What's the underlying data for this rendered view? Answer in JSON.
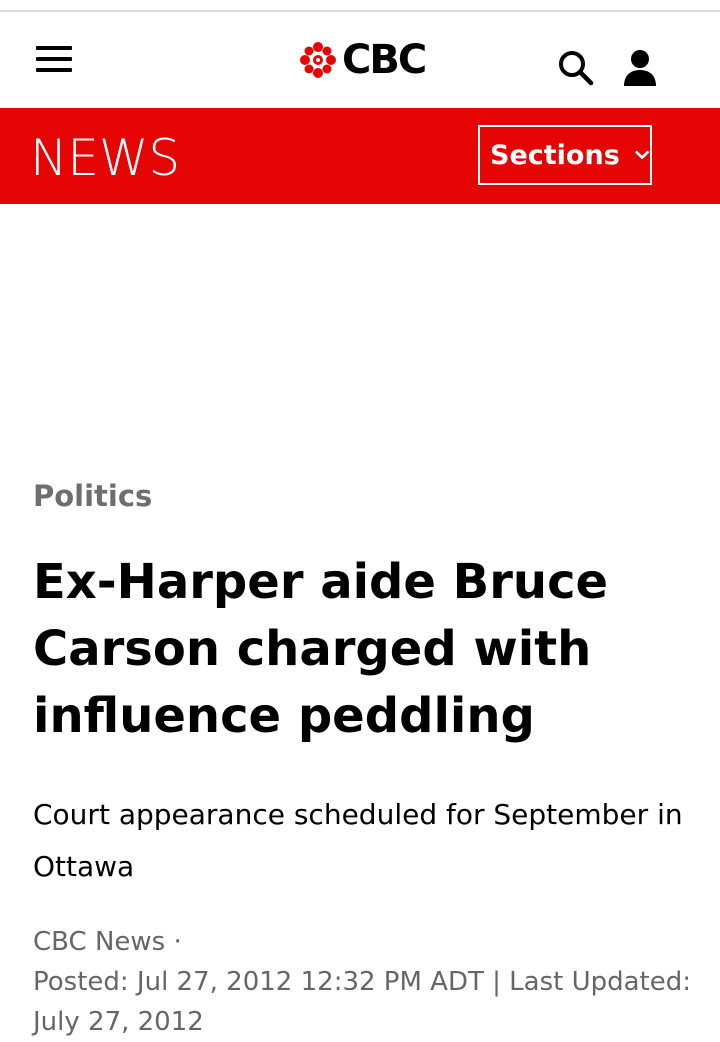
{
  "header": {
    "logo_text": "CBC",
    "menu_icon": "hamburger-menu-icon",
    "search_icon": "search-icon",
    "account_icon": "user-account-icon"
  },
  "newsbar": {
    "title": "NEWS",
    "sections_label": "Sections",
    "background_color": "#e60505"
  },
  "article": {
    "category": "Politics",
    "headline": "Ex-Harper aide Bruce Carson charged with influence peddling",
    "deck": "Court appearance scheduled for September in Ottawa",
    "byline": "CBC News ·",
    "posted": "Posted: Jul 27, 2012 12:32 PM ADT | Last Updated: July 27, 2012"
  }
}
